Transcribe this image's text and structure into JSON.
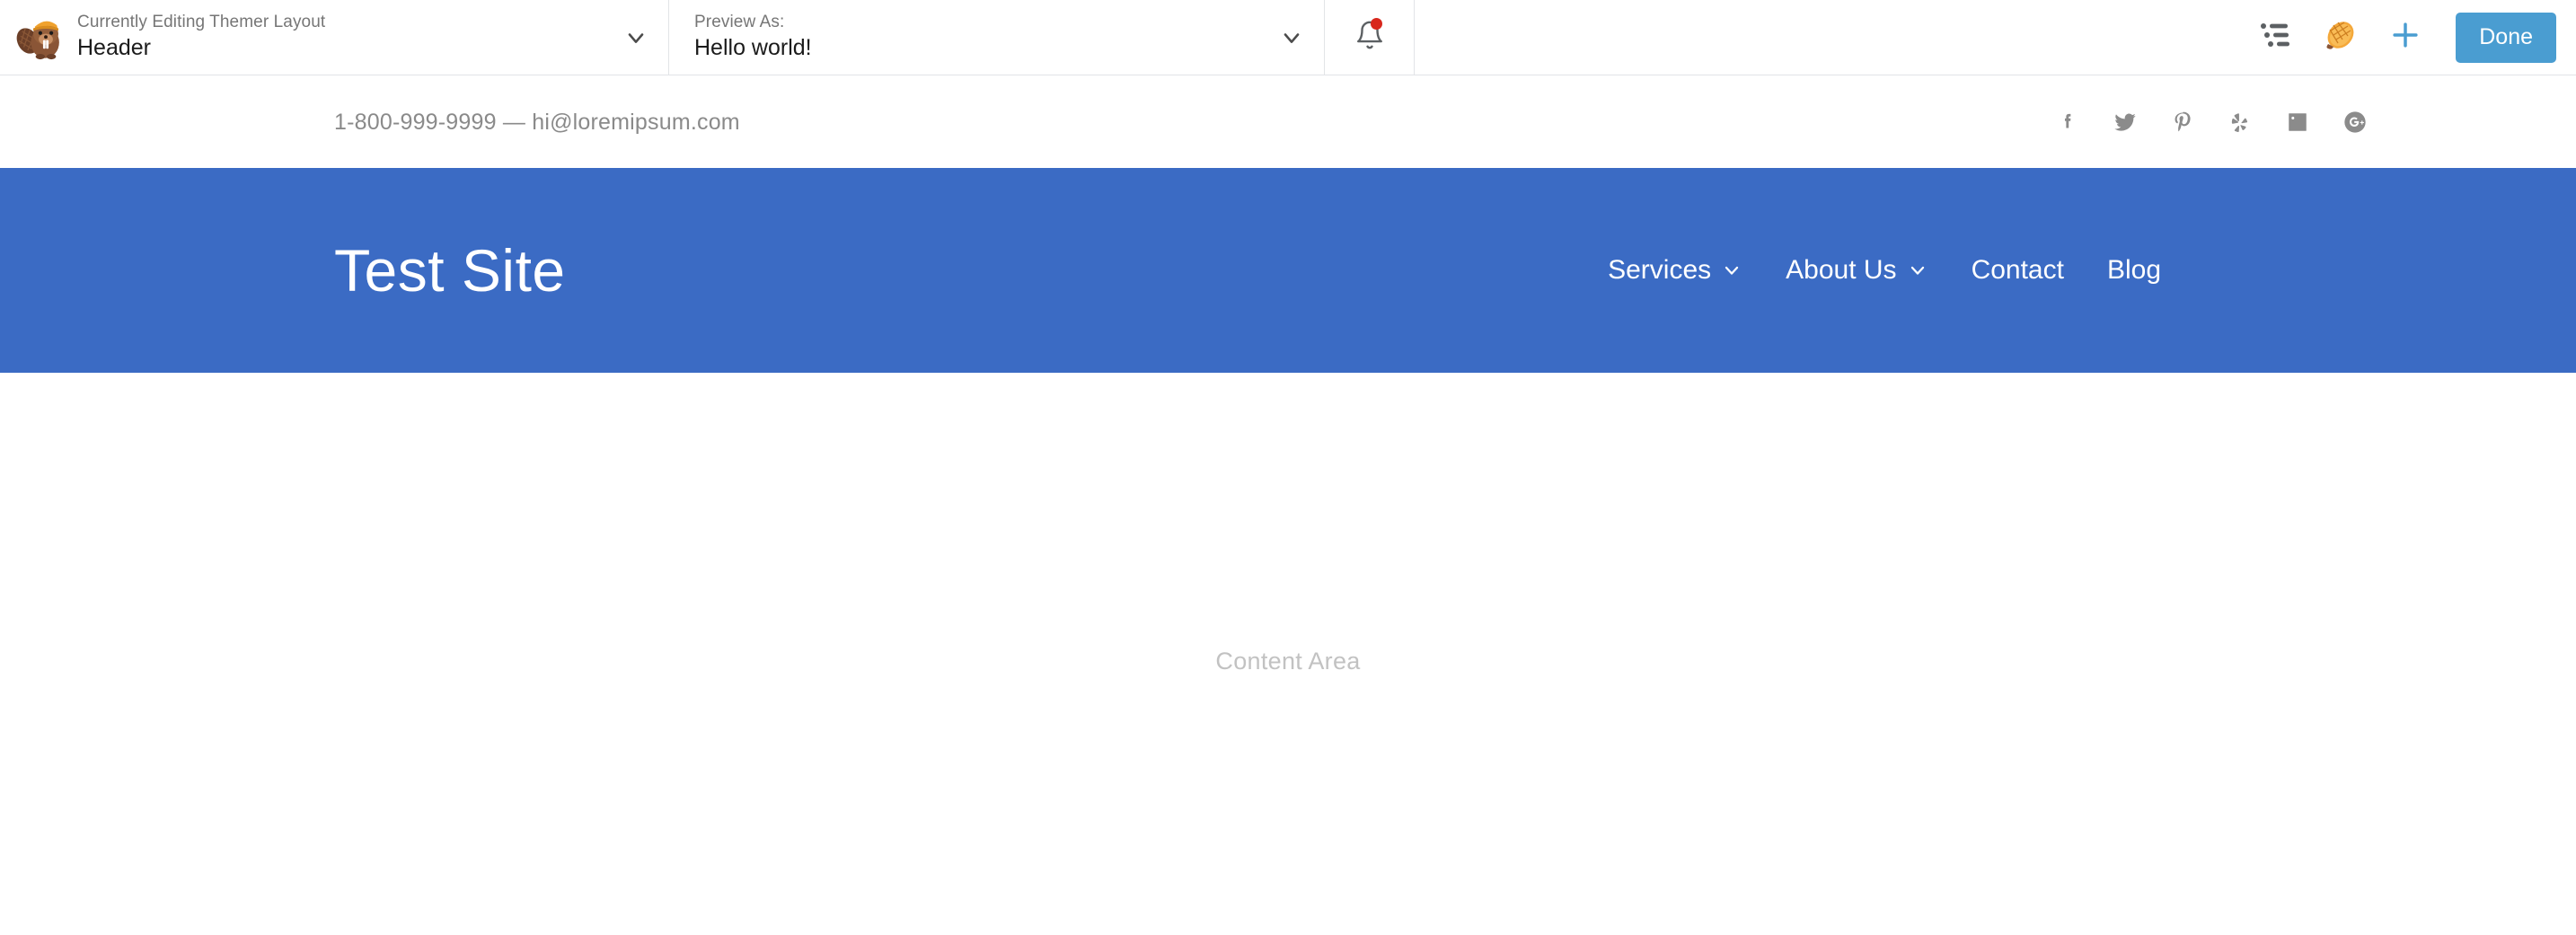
{
  "admin_bar": {
    "logo_icon": "beaver-builder-logo-icon",
    "layout_dropdown": {
      "label": "Currently Editing Themer Layout",
      "value": "Header",
      "caret_icon": "chevron-down-icon"
    },
    "preview_dropdown": {
      "label": "Preview As:",
      "value": "Hello world!",
      "caret_icon": "chevron-down-icon"
    },
    "notifications": {
      "icon": "bell-icon",
      "has_unread_badge": true,
      "badge_color": "#d8271c"
    },
    "actions": [
      {
        "icon": "outline-list-icon",
        "name": "outline-button"
      },
      {
        "icon": "beaver-tail-tools-icon",
        "name": "tools-button"
      },
      {
        "icon": "plus-icon",
        "name": "add-content-button"
      }
    ],
    "done_label": "Done",
    "done_color": "#4a9dd1"
  },
  "site": {
    "topbar": {
      "contact": "1-800-999-9999 — hi@loremipsum.com",
      "social": [
        {
          "name": "facebook",
          "icon": "facebook-icon"
        },
        {
          "name": "twitter",
          "icon": "twitter-icon"
        },
        {
          "name": "pinterest",
          "icon": "pinterest-icon"
        },
        {
          "name": "yelp",
          "icon": "yelp-icon"
        },
        {
          "name": "linkedin",
          "icon": "linkedin-icon"
        },
        {
          "name": "googleplus",
          "icon": "google-plus-icon"
        }
      ]
    },
    "header": {
      "background_color": "#3b6bc4",
      "title": "Test Site",
      "nav": [
        {
          "label": "Services",
          "has_submenu": true
        },
        {
          "label": "About Us",
          "has_submenu": true
        },
        {
          "label": "Contact",
          "has_submenu": false
        },
        {
          "label": "Blog",
          "has_submenu": false
        }
      ]
    },
    "content": {
      "placeholder": "Content Area"
    }
  }
}
